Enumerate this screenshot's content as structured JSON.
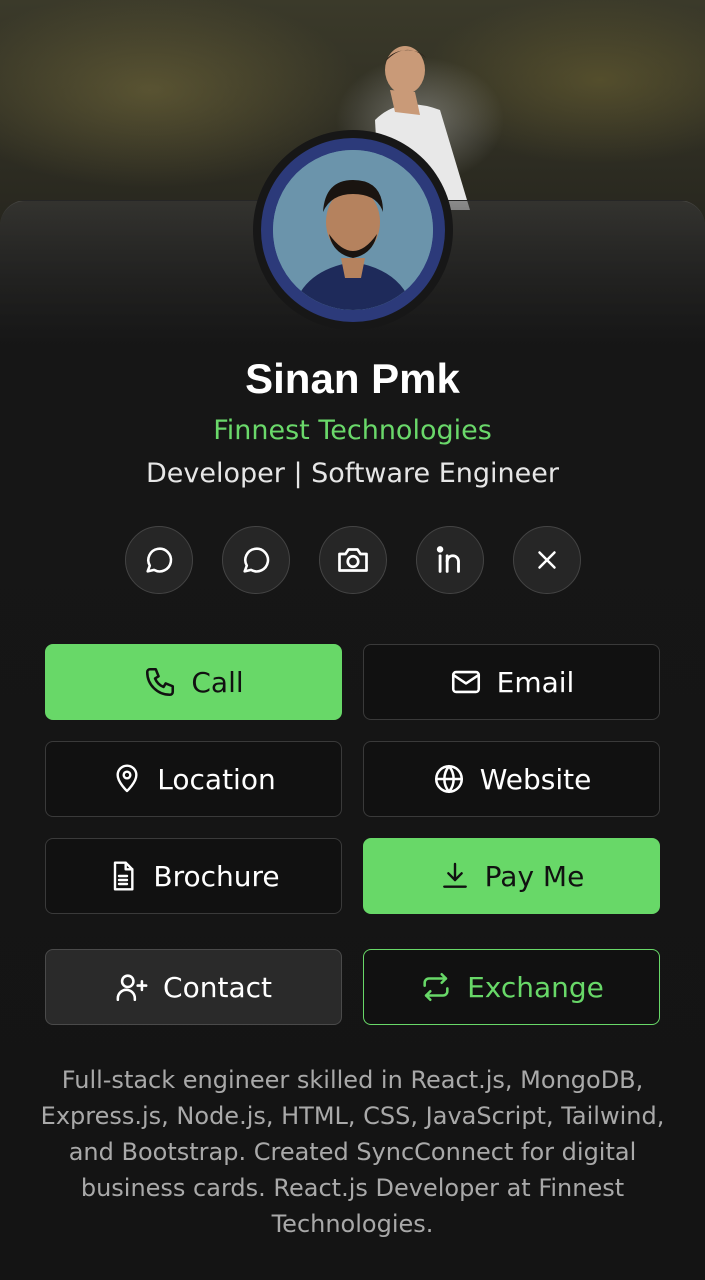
{
  "profile": {
    "name": "Sinan Pmk",
    "company": "Finnest Technologies",
    "role": "Developer | Software Engineer",
    "bio": "Full-stack engineer skilled in React.js, MongoDB, Express.js, Node.js, HTML, CSS, JavaScript, Tailwind, and Bootstrap. Created SyncConnect for digital business cards. React.js Developer at Finnest Technologies."
  },
  "socials": [
    {
      "icon": "chat-bubble-icon"
    },
    {
      "icon": "chat-bubble-icon"
    },
    {
      "icon": "camera-icon"
    },
    {
      "icon": "linkedin-icon"
    },
    {
      "icon": "x-icon"
    }
  ],
  "actions": {
    "call": {
      "label": "Call",
      "icon": "phone-icon"
    },
    "email": {
      "label": "Email",
      "icon": "mail-icon"
    },
    "location": {
      "label": "Location",
      "icon": "map-pin-icon"
    },
    "website": {
      "label": "Website",
      "icon": "globe-icon"
    },
    "brochure": {
      "label": "Brochure",
      "icon": "document-icon"
    },
    "pay": {
      "label": "Pay Me",
      "icon": "download-icon"
    },
    "contact": {
      "label": "Contact",
      "icon": "add-user-icon"
    },
    "exchange": {
      "label": "Exchange",
      "icon": "exchange-arrows-icon"
    }
  },
  "colors": {
    "accent": "#68d868",
    "background": "#141414",
    "avatar_ring": "#2c3a7a"
  }
}
